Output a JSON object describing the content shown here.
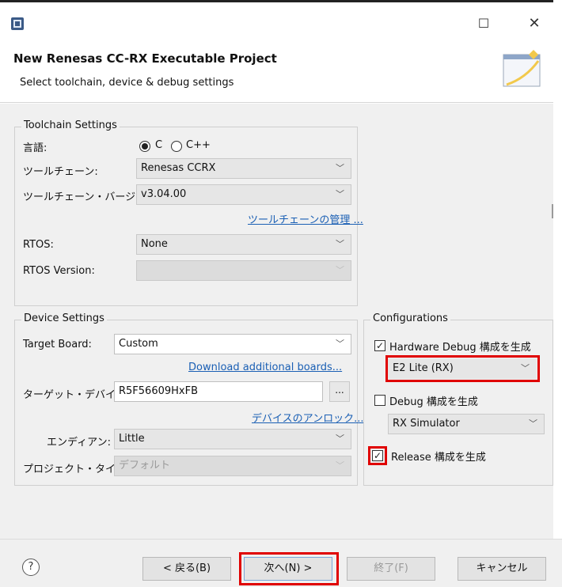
{
  "window": {
    "title": "New Renesas CC-RX Executable Project",
    "subtitle": "Select toolchain, device & debug settings",
    "maximize_glyph": "☐",
    "close_glyph": "✕"
  },
  "toolchain": {
    "legend": "Toolchain Settings",
    "language_label": "言語:",
    "lang_c": "C",
    "lang_cpp": "C++",
    "language_selected": "C",
    "toolchain_label": "ツールチェーン:",
    "toolchain_value": "Renesas CCRX",
    "version_label": "ツールチェーン・バージョン:",
    "version_value": "v3.04.00",
    "manage_link": "ツールチェーンの管理 ...",
    "rtos_label": "RTOS:",
    "rtos_value": "None",
    "rtos_version_label": "RTOS Version:",
    "rtos_version_value": ""
  },
  "device": {
    "legend": "Device Settings",
    "target_board_label": "Target Board:",
    "target_board_value": "Custom",
    "download_link": "Download additional boards...",
    "target_device_label": "ターゲット・デバイス:",
    "target_device_value": "R5F56609HxFB",
    "browse_label": "...",
    "unlock_link": "デバイスのアンロック...",
    "endian_label": "エンディアン:",
    "endian_value": "Little",
    "project_type_label": "プロジェクト・タイプ:",
    "project_type_value": "デフォルト"
  },
  "configurations": {
    "legend": "Configurations",
    "hw_debug_label": "Hardware Debug 構成を生成",
    "hw_debug_checked": true,
    "hw_debug_tool": "E2 Lite (RX)",
    "debug_label": "Debug 構成を生成",
    "debug_checked": false,
    "debug_tool": "RX Simulator",
    "release_label": "Release 構成を生成",
    "release_checked": true
  },
  "footer": {
    "help_glyph": "?",
    "back_label": "< 戻る(B)",
    "next_label": "次へ(N) >",
    "finish_label": "終了(F)",
    "cancel_label": "キャンセル"
  },
  "colors": {
    "highlight": "#e00000",
    "link": "#1a5fb4",
    "dialog_bg": "#f0f0f0"
  }
}
